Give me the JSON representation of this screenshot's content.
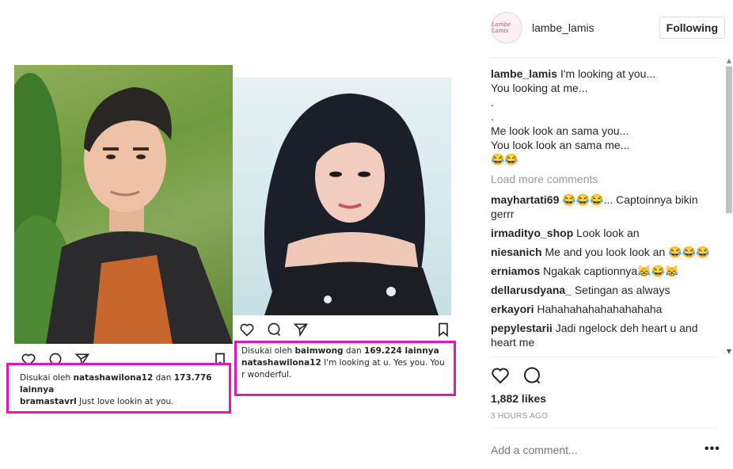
{
  "post": {
    "username": "lambe_lamis",
    "avatar_text": "Lambe Lamis",
    "follow_label": "Following",
    "caption_lines": [
      "I'm looking at you...",
      "You looking at me...",
      ".",
      ".",
      "Me look look an sama you...",
      "You look look an sama me...",
      "😂😂"
    ],
    "load_more": "Load more comments",
    "comments": [
      {
        "user": "mayhartati69",
        "text": "😂😂😂... Captoinnya bikin gerrr"
      },
      {
        "user": "irmadityo_shop",
        "text": "Look look an"
      },
      {
        "user": "niesanich",
        "text": "Me and you look look an 😂😂😂"
      },
      {
        "user": "erniamos",
        "text": "Ngakak captionnya😹😂😹"
      },
      {
        "user": "dellarusdyana_",
        "text": "Setingan as always"
      },
      {
        "user": "erkayori",
        "text": "Hahahahahahahahahaha"
      },
      {
        "user": "pepylestarii",
        "text": "Jadi ngelock deh heart u and heart me"
      }
    ],
    "likes": "1,882 likes",
    "time_ago": "3 HOURS AGO",
    "add_comment_placeholder": "Add a comment...",
    "more_label": "•••"
  },
  "media": {
    "left_caption": {
      "liked_prefix": "Disukai oleh",
      "liked_user": "natashawilona12",
      "liked_mid": "dan",
      "liked_count": "173.776 lainnya",
      "author": "bramastavrl",
      "text": "Just love lookin at you."
    },
    "right_caption": {
      "liked_prefix": "Disukai oleh",
      "liked_user": "baimwong",
      "liked_mid": "dan",
      "liked_count": "169.224 lainnya",
      "author": "natashawilona12",
      "text": "I'm looking at u. Yes you. You r wonderful."
    },
    "highlight_color": "#e01aab"
  },
  "icons": {
    "heart": "heart-icon",
    "comment": "comment-icon",
    "share": "share-icon",
    "bookmark": "bookmark-icon",
    "more": "more-options-icon"
  }
}
